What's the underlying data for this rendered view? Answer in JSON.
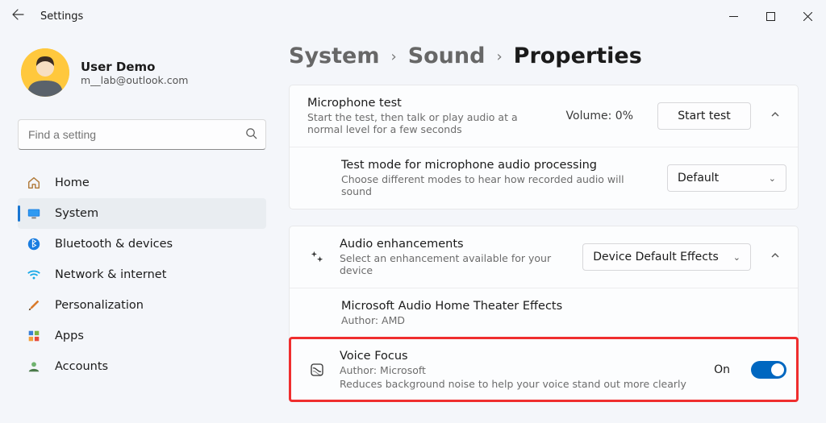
{
  "app_title": "Settings",
  "user": {
    "name": "User Demo",
    "email": "m__lab@outlook.com"
  },
  "search_placeholder": "Find a setting",
  "nav": [
    {
      "key": "home",
      "label": "Home"
    },
    {
      "key": "system",
      "label": "System"
    },
    {
      "key": "bluetooth",
      "label": "Bluetooth & devices"
    },
    {
      "key": "network",
      "label": "Network & internet"
    },
    {
      "key": "personalization",
      "label": "Personalization"
    },
    {
      "key": "apps",
      "label": "Apps"
    },
    {
      "key": "accounts",
      "label": "Accounts"
    }
  ],
  "breadcrumbs": {
    "a": "System",
    "b": "Sound",
    "c": "Properties"
  },
  "mic_test": {
    "title": "Microphone test",
    "sub": "Start the test, then talk or play audio at a normal level for a few seconds",
    "volume_label": "Volume: 0%",
    "button": "Start test"
  },
  "test_mode": {
    "title": "Test mode for microphone audio processing",
    "sub": "Choose different modes to hear how recorded audio will sound",
    "value": "Default"
  },
  "enhancements": {
    "title": "Audio enhancements",
    "sub": "Select an enhancement available for your device",
    "value": "Device Default Effects"
  },
  "ms_audio": {
    "title": "Microsoft Audio Home Theater Effects",
    "sub": "Author: AMD"
  },
  "voice_focus": {
    "title": "Voice Focus",
    "author": "Author: Microsoft",
    "desc": "Reduces background noise to help your voice stand out more clearly",
    "state_label": "On"
  }
}
